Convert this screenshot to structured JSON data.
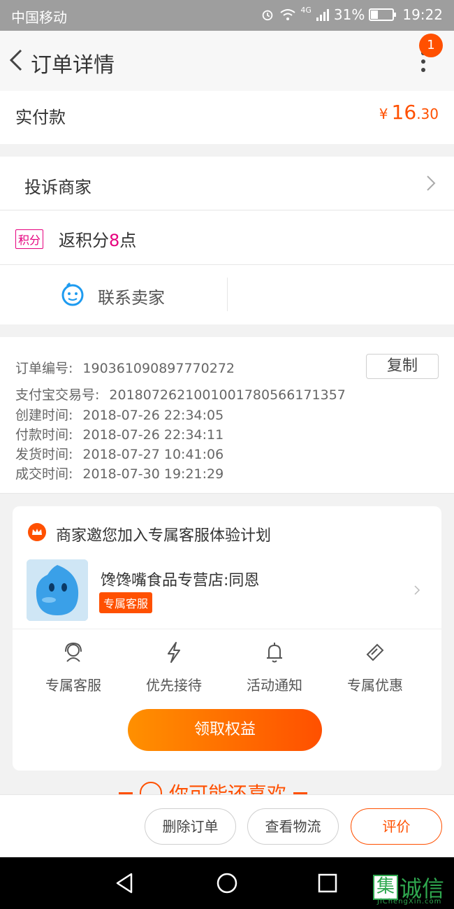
{
  "status_bar": {
    "carrier": "中国移动",
    "network": "4G",
    "battery": "31%",
    "battery_fraction": 0.31,
    "time": "19:22"
  },
  "nav": {
    "title": "订单详情",
    "badge_count": "1"
  },
  "payment": {
    "label": "实付款",
    "currency": "¥",
    "amount_int": "16",
    "amount_dec": ".30"
  },
  "actions": {
    "complain_label": "投诉商家",
    "points_tag": "积分",
    "points_prefix": "返积分",
    "points_value": "8",
    "points_suffix": "点",
    "contact_label": "联系卖家"
  },
  "order_info": {
    "copy_label": "复制",
    "lines": [
      {
        "key": "订单编号:",
        "value": "190361090897770272"
      },
      {
        "key": "支付宝交易号:",
        "value": "2018072621001001780566171357"
      },
      {
        "key": "创建时间:",
        "value": "2018-07-26 22:34:05"
      },
      {
        "key": "付款时间:",
        "value": "2018-07-26 22:34:11"
      },
      {
        "key": "发货时间:",
        "value": "2018-07-27 10:41:06"
      },
      {
        "key": "成交时间:",
        "value": "2018-07-30 19:21:29"
      }
    ]
  },
  "service_plan": {
    "headline": "商家邀您加入专属客服体验计划",
    "shop_name": "馋馋嘴食品专营店:同恩",
    "shop_tag": "专属客服",
    "benefits": [
      {
        "label": "专属客服",
        "icon": "headset-icon"
      },
      {
        "label": "优先接待",
        "icon": "lightning-icon"
      },
      {
        "label": "活动通知",
        "icon": "bell-icon"
      },
      {
        "label": "专属优惠",
        "icon": "ticket-icon"
      }
    ],
    "claim_label": "领取权益"
  },
  "recommend": {
    "title": "你可能还喜欢"
  },
  "bottom_bar": {
    "delete_label": "删除订单",
    "logistics_label": "查看物流",
    "review_label": "评价"
  },
  "watermark": {
    "box_char": "集",
    "text": "诚信",
    "sub": "JiChengXin.com"
  },
  "colors": {
    "accent": "#ff5000",
    "points": "#e6007e",
    "status_bar": "#9e9e9e"
  }
}
